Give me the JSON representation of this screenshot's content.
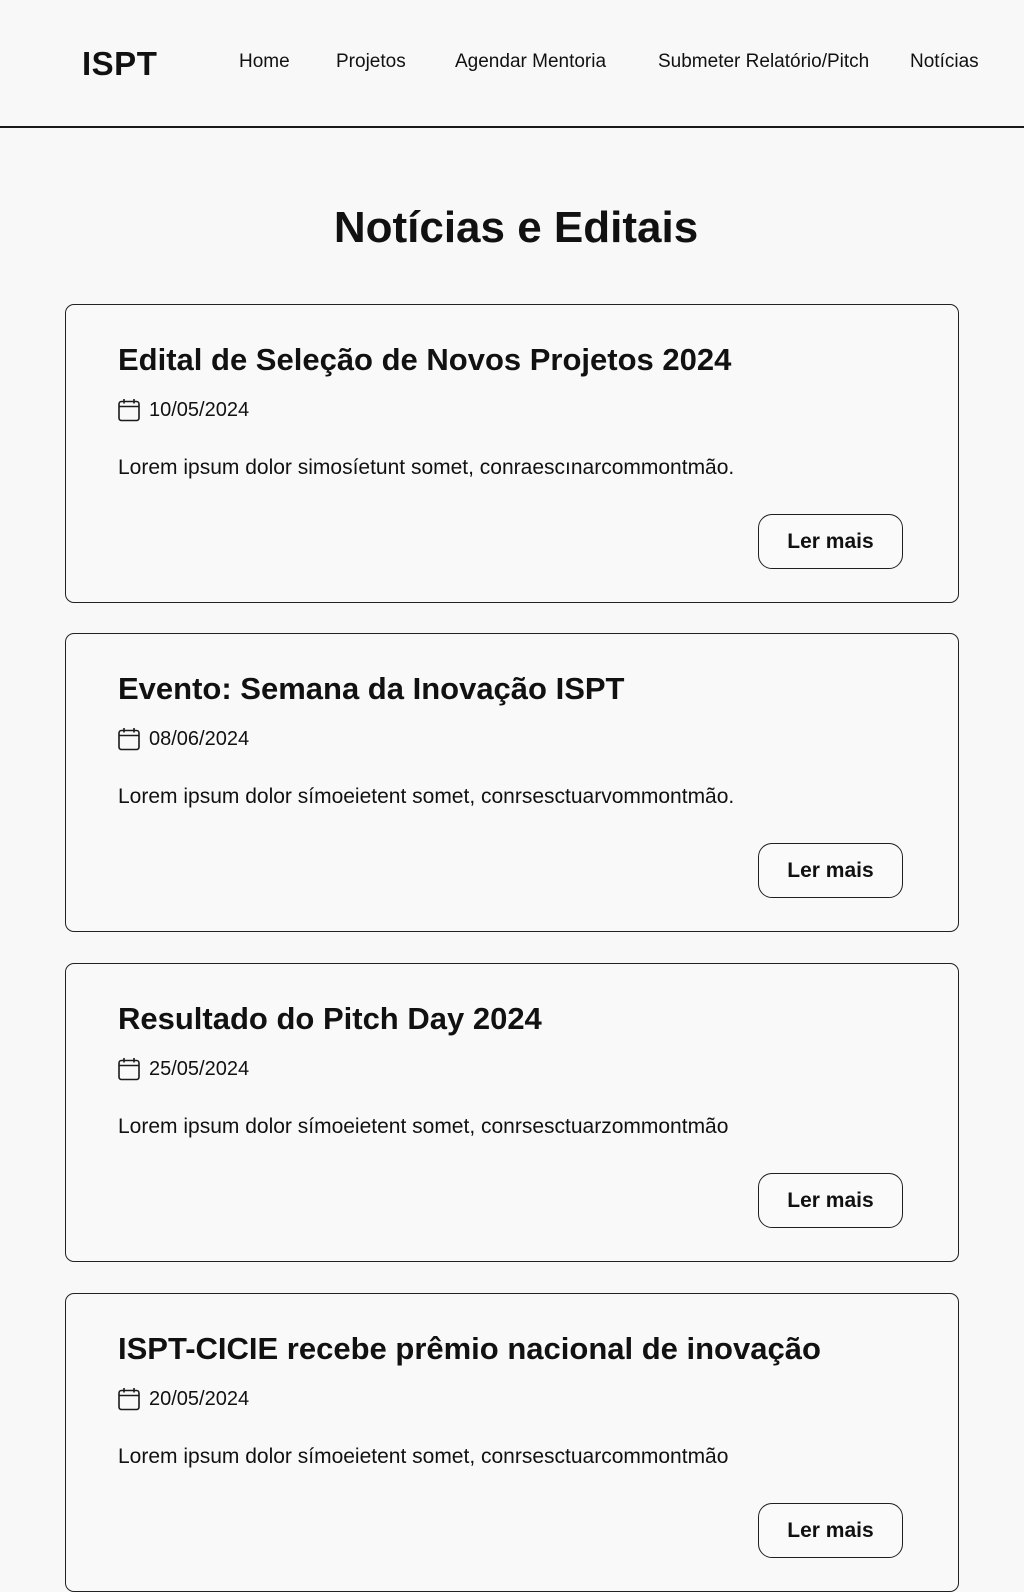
{
  "header": {
    "brand": "ISPT",
    "nav": [
      "Home",
      "Projetos",
      "Agendar Mentoria",
      "Submeter Relatório/Pitch",
      "Notícias"
    ]
  },
  "main": {
    "title": "Notícias e Editais",
    "read_more_label": "Ler mais",
    "date_icon": "calendar-icon",
    "items": [
      {
        "title": "Edital de Seleção de Novos Projetos 2024",
        "date": "10/05/2024",
        "excerpt": "Lorem ipsum dolor simosíetunt somet, conraescınarcommontmão."
      },
      {
        "title": "Evento: Semana da Inovação ISPT",
        "date": "08/06/2024",
        "excerpt": "Lorem ipsum dolor símoeietent somet, conrsesctuarvommontmão."
      },
      {
        "title": "Resultado do Pitch Day 2024",
        "date": "25/05/2024",
        "excerpt": "Lorem ipsum dolor símoeietent somet, conrsesctuarzommontmão"
      },
      {
        "title": "ISPT-CICIE recebe prêmio nacional de inovação",
        "date": "20/05/2024",
        "excerpt": "Lorem ipsum dolor símoeietent somet, conrsesctuarcommontmão"
      }
    ]
  },
  "colors": {
    "background": "#f8f8f8",
    "text": "#111111",
    "border": "#222222"
  }
}
